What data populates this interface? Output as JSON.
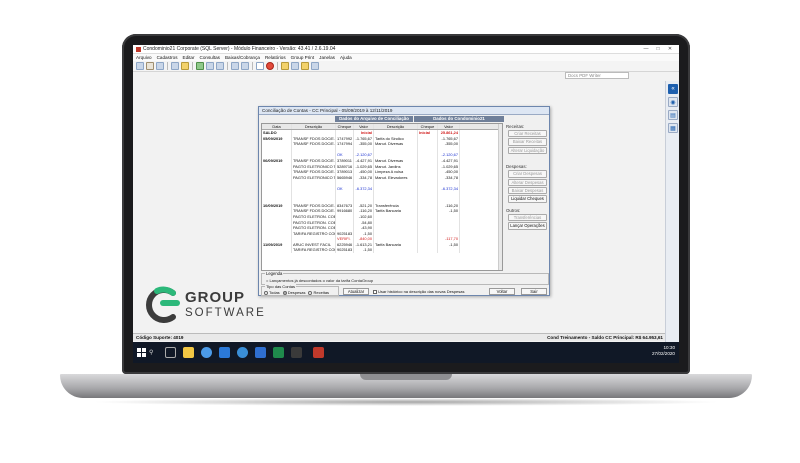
{
  "app": {
    "title": "Condominio21 Corporate (SQL Server) - Módulo Financeiro - Versão: 43.41 / 2.6.19.04",
    "menu": [
      "Arquivo",
      "Cadastros",
      "Editar",
      "Consultas",
      "Baixas/Cobrança",
      "Relatórios",
      "Group Print",
      "Janelas",
      "Ajuda"
    ],
    "search_placeholder": "Docs PDF Writer"
  },
  "dialog": {
    "title": "Conciliação de Contas - CC Principal - 05/09/2019 à 12/11/2019",
    "section_left": "Dados do Arquivo de Conciliação",
    "section_right": "Dados do Condominio21",
    "columns": [
      "Data",
      "Descrição",
      "Cheque",
      "Valor",
      "Descrição",
      "Cheque",
      "Valor"
    ],
    "rows": [
      {
        "data": "SALDO",
        "d1": "",
        "ch1": "",
        "v1": "Inicial",
        "d2": "",
        "ch2": "Inicial",
        "v2": "25.861,24",
        "style": "saldo"
      },
      {
        "data": "05/09/2019",
        "d1": "TRANSF FDOS DOC/E.H BANK",
        "ch1": "1747992",
        "v1": "-1.765,67",
        "d2": "Tarifa do Sindico",
        "ch2": "",
        "v2": "-1.765,67",
        "style": "date"
      },
      {
        "data": "",
        "d1": "TRANSF FDOS DOC/E.H BANK",
        "ch1": "1747994",
        "v1": "-355,00",
        "d2": "Manut. Diversas",
        "ch2": "",
        "v2": "-355,00",
        "style": ""
      },
      {
        "data": "",
        "d1": "",
        "ch1": "",
        "v1": "",
        "d2": "",
        "ch2": "",
        "v2": "",
        "style": ""
      },
      {
        "data": "",
        "d1": "",
        "ch1": "OK",
        "v1": "-2.120,67",
        "d2": "",
        "ch2": "",
        "v2": "-2.120,67",
        "style": "ok"
      },
      {
        "data": "06/09/2019",
        "d1": "TRANSF FDOS DOC/E.H BANK",
        "ch1": "3789011",
        "v1": "-4.427,91",
        "d2": "Manut. Diversas",
        "ch2": "",
        "v2": "-4.427,91",
        "style": "date"
      },
      {
        "data": "",
        "d1": "PAGTO ELETRONICO TRIBUTO",
        "ch1": "5289716",
        "v1": "-1.029,65",
        "d2": "Manut. Jardins",
        "ch2": "",
        "v2": "-1.029,65",
        "style": ""
      },
      {
        "data": "",
        "d1": "TRANSF FDOS DOC/E.H BANK",
        "ch1": "3789013",
        "v1": "-450,00",
        "d2": "Limpeza A vulsa",
        "ch2": "",
        "v2": "-450,00",
        "style": ""
      },
      {
        "data": "",
        "d1": "PAGTO ELETRONICO TRIBUTO",
        "ch1": "5665946",
        "v1": "-334,78",
        "d2": "Manut. Elevadores",
        "ch2": "",
        "v2": "-334,78",
        "style": ""
      },
      {
        "data": "",
        "d1": "",
        "ch1": "",
        "v1": "",
        "d2": "",
        "ch2": "",
        "v2": "",
        "style": ""
      },
      {
        "data": "",
        "d1": "",
        "ch1": "OK",
        "v1": "-6.372,34",
        "d2": "",
        "ch2": "",
        "v2": "-6.372,34",
        "style": "ok"
      },
      {
        "data": "",
        "d1": "",
        "ch1": "",
        "v1": "",
        "d2": "",
        "ch2": "",
        "v2": "",
        "style": ""
      },
      {
        "data": "",
        "d1": "",
        "ch1": "",
        "v1": "",
        "d2": "",
        "ch2": "",
        "v2": "",
        "style": ""
      },
      {
        "data": "10/09/2019",
        "d1": "TRANSF FDOS DOC/E.H BANK",
        "ch1": "8347673",
        "v1": "-521,20",
        "d2": "Transferência",
        "ch2": "",
        "v2": "-116,20",
        "style": "date"
      },
      {
        "data": "",
        "d1": "TRANSF FDOS DOC/E.H BANK",
        "ch1": "9916680",
        "v1": "-116,20",
        "d2": "Tarifa Bancaria",
        "ch2": "",
        "v2": "-1,50",
        "style": ""
      },
      {
        "data": "",
        "d1": "PAGTO ELETRON. COBRANCA 3",
        "ch1": "",
        "v1": "-102,60",
        "d2": "",
        "ch2": "",
        "v2": "",
        "style": ""
      },
      {
        "data": "",
        "d1": "PAGTO ELETRON. COBRANCA 6",
        "ch1": "",
        "v1": "-54,80",
        "d2": "",
        "ch2": "",
        "v2": "",
        "style": ""
      },
      {
        "data": "",
        "d1": "PAGTO ELETRON. COBRANCA 8",
        "ch1": "",
        "v1": "-43,90",
        "d2": "",
        "ch2": "",
        "v2": "",
        "style": ""
      },
      {
        "data": "",
        "d1": "TARIFA REGISTRO COBRANCA",
        "ch1": "9025183",
        "v1": "-1,50",
        "d2": "",
        "ch2": "",
        "v2": "",
        "style": ""
      },
      {
        "data": "",
        "d1": "",
        "ch1": "VERIFI.",
        "v1": "-840,00",
        "d2": "",
        "ch2": "",
        "v2": "-117,70",
        "style": "verifi"
      },
      {
        "data": "11/09/2019",
        "d1": "ARUC INVEST FACIL",
        "ch1": "6225946",
        "v1": "-1.613,21",
        "d2": "Tarifa Bancaria",
        "ch2": "",
        "v2": "-1,50",
        "style": "date"
      },
      {
        "data": "",
        "d1": "TARIFA REGISTRO COBRANCA",
        "ch1": "9025183",
        "v1": "-1,50",
        "d2": "",
        "ch2": "",
        "v2": "",
        "style": ""
      }
    ],
    "groups": {
      "receitas": {
        "label": "Receitas:",
        "buttons": [
          "Criar Receitas",
          "Baixar Receitas",
          "Alterar Liquidação"
        ]
      },
      "despesas": {
        "label": "Despesas:",
        "buttons": [
          "Criar Despesas",
          "Alterar Despesas",
          "Baixar Despesas",
          "Liquidar Cheques"
        ]
      },
      "outros": {
        "label": "Outros:",
        "buttons": [
          "Transferências",
          "Lançar Operações"
        ]
      }
    },
    "legend": {
      "label": "Legenda",
      "text": "= Lançamentos já descontados o valor da tarifa ContaGroup"
    },
    "tipo": {
      "label": "Tipo das Contas",
      "options": [
        "Todas",
        "Despesas",
        "Receitas"
      ],
      "selected": "Despesas"
    },
    "atualizar": "Atualizar",
    "checkbox": "Usar histórico na descrição das novas Despesas",
    "voltar": "Voltar",
    "sair": "Sair"
  },
  "statusbar": {
    "left": "Código Suporte:  4019",
    "right": "Cond Treinamento - Saldo CC Principal: R$ 64.953,61"
  },
  "taskbar": {
    "search": "⚲",
    "time": "10:30",
    "date": "27/02/2020"
  },
  "logo": {
    "line1": "GROUP",
    "line2": "SOFTWARE",
    "color_green": "#2cb87a",
    "color_gray": "#3c3c3c"
  }
}
